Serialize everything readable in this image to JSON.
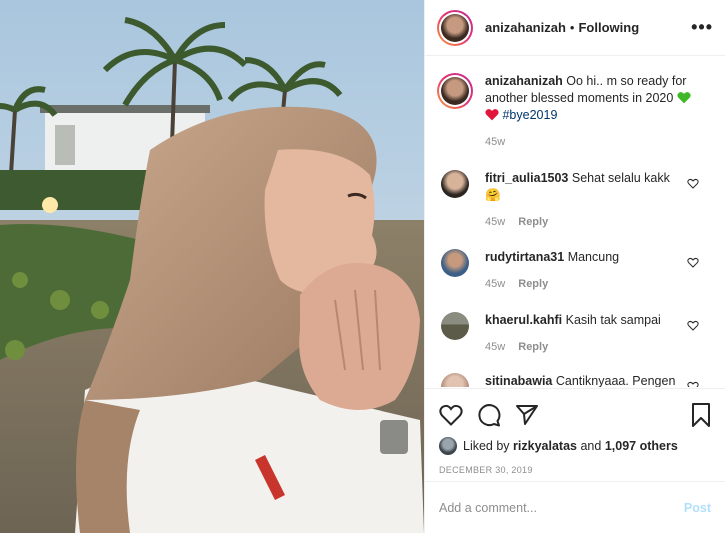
{
  "header": {
    "username": "anizahanizah",
    "separator": "•",
    "follow_status": "Following",
    "more_label": "•••"
  },
  "caption": {
    "username": "anizahanizah",
    "text_part1": "Oo hi.. m so ready for another blessed moments in 2020",
    "hashtag": "#bye2019",
    "time": "45w"
  },
  "comments": [
    {
      "username": "fitri_aulia1503",
      "text": "Sehat selalu kakk",
      "emoji": "🤗",
      "time": "45w",
      "reply": "Reply"
    },
    {
      "username": "rudytirtana31",
      "text": "Mancung",
      "time": "45w",
      "reply": "Reply"
    },
    {
      "username": "khaerul.kahfi",
      "text": "Kasih tak sampai",
      "time": "45w",
      "reply": "Reply"
    },
    {
      "username": "sitinabawia",
      "text": "Cantiknyaaa. Pengen",
      "time": "",
      "reply": ""
    }
  ],
  "likes": {
    "prefix": "Liked by",
    "user": "rizkyalatas",
    "and": "and",
    "others": "1,097 others"
  },
  "date": "DECEMBER 30, 2019",
  "add_comment": {
    "placeholder": "Add a comment...",
    "post_label": "Post"
  },
  "colors": {
    "accent_link": "#00376b",
    "post_button": "#b2dffc",
    "muted": "#8e8e8e",
    "green_heart": "#3fb828",
    "red_heart": "#e0143c"
  },
  "icons": {
    "more": "more-options-icon",
    "like": "heart-icon",
    "comment": "comment-bubble-icon",
    "share": "paper-plane-icon",
    "save": "bookmark-icon"
  }
}
